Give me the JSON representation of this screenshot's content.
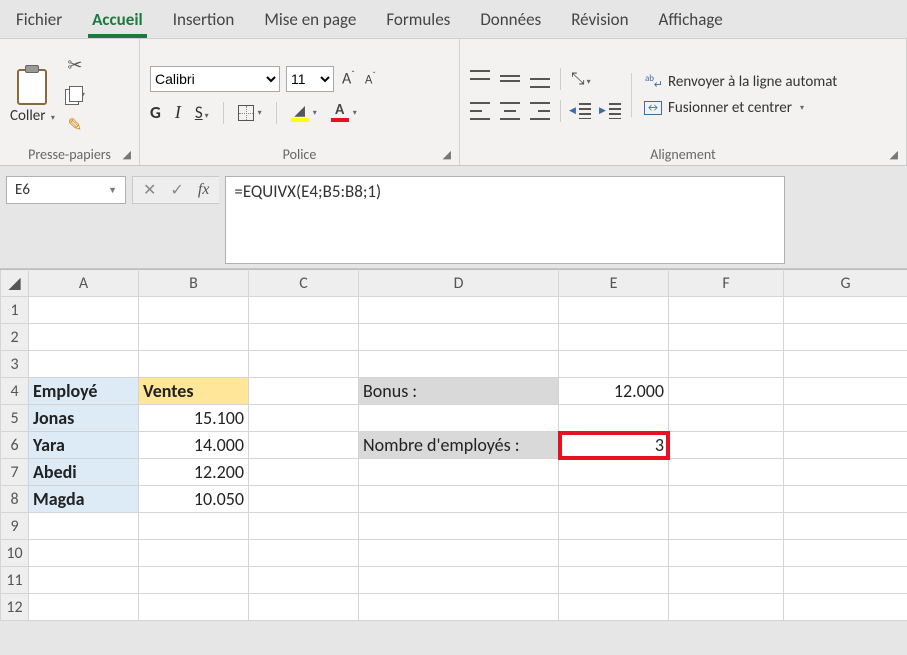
{
  "menu": {
    "tabs": [
      "Fichier",
      "Accueil",
      "Insertion",
      "Mise en page",
      "Formules",
      "Données",
      "Révision",
      "Affichage"
    ],
    "active_index": 1
  },
  "ribbon": {
    "clipboard": {
      "paste": "Coller",
      "group": "Presse-papiers"
    },
    "font": {
      "group": "Police",
      "name": "Calibri",
      "size": "11",
      "bold": "G",
      "italic": "I",
      "underline": "S",
      "grow_char": "A",
      "shrink_char": "A",
      "color_char": "A",
      "highlight_color": "#ffff00",
      "font_color": "#e81123"
    },
    "align": {
      "group": "Alignement",
      "wrap": "Renvoyer à la ligne automat",
      "merge": "Fusionner et centrer"
    }
  },
  "formulabar": {
    "cellref": "E6",
    "formula": "=EQUIVX(E4;B5:B8;1)"
  },
  "grid": {
    "columns": [
      "A",
      "B",
      "C",
      "D",
      "E",
      "F",
      "G"
    ],
    "row_count": 12,
    "cells": {
      "A4": "Employé",
      "B4": "Ventes",
      "A5": "Jonas",
      "B5": "15.100",
      "A6": "Yara",
      "B6": "14.000",
      "A7": "Abedi",
      "B7": "12.200",
      "A8": "Magda",
      "B8": "10.050",
      "D4": "Bonus :",
      "E4": "12.000",
      "D6": "Nombre d'employés :",
      "E6": "3"
    },
    "highlight_cell": "E6"
  },
  "chart_data": {
    "type": "table",
    "title": "Employé / Ventes",
    "columns": [
      "Employé",
      "Ventes"
    ],
    "rows": [
      [
        "Jonas",
        15100
      ],
      [
        "Yara",
        14000
      ],
      [
        "Abedi",
        12200
      ],
      [
        "Magda",
        10050
      ]
    ],
    "derived": {
      "Bonus": 12000,
      "Nombre d'employés": 3,
      "formula": "=EQUIVX(E4;B5:B8;1)"
    }
  }
}
